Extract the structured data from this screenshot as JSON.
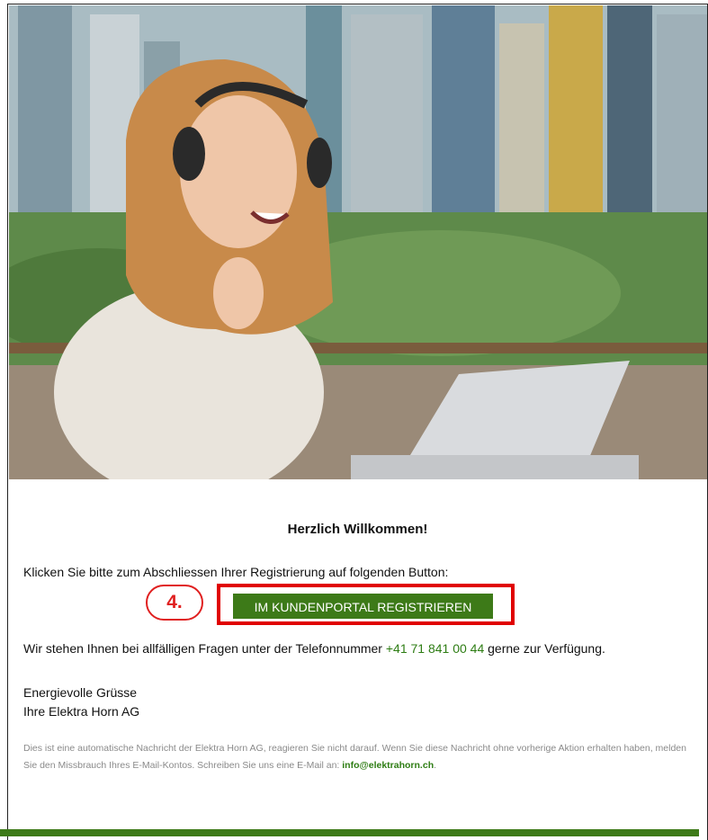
{
  "email": {
    "hero_image": "woman-with-headphones-laptop-photo",
    "heading": "Herzlich Willkommen!",
    "intro_text": "Klicken Sie bitte zum Abschliessen Ihrer Registrierung auf folgenden Button:",
    "step_label": "4.",
    "cta_label": "IM KUNDENPORTAL REGISTRIEREN",
    "phone_prefix": "Wir stehen Ihnen bei allfälligen Fragen unter der Telefonnummer ",
    "phone_number": "+41 71 841 00 44",
    "phone_suffix": " gerne zur Verfügung.",
    "greeting_line1": "Energievolle Grüsse",
    "greeting_line2": "Ihre Elektra Horn AG",
    "disclaimer_text": "Dies ist eine automatische Nachricht der Elektra Horn AG, reagieren Sie nicht darauf. Wenn Sie diese Nachricht ohne vorherige Aktion erhalten haben, melden Sie den Missbrauch Ihres E-Mail-Kontos. Schreiben Sie uns eine E-Mail an: ",
    "contact_email": "info@elektrahorn.ch",
    "disclaimer_end": "."
  },
  "colors": {
    "brand_green": "#3d7a18",
    "annotation_red": "#e00000",
    "link_green": "#2e7d14"
  }
}
